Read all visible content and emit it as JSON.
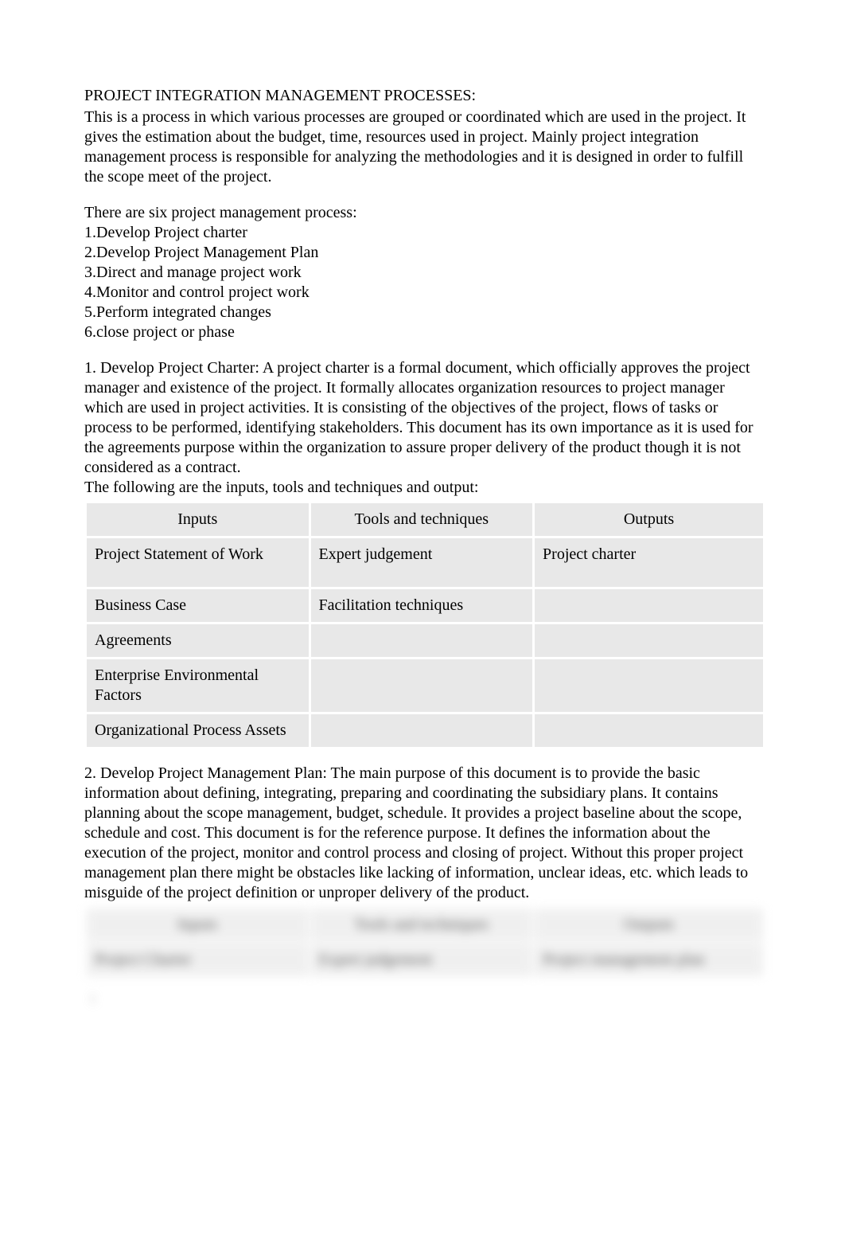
{
  "title": "PROJECT INTEGRATION MANAGEMENT PROCESSES:",
  "intro": "This is a process in which various processes are grouped or coordinated which are used in the project. It gives the estimation about the budget, time, resources used in project. Mainly project integration management process is responsible for analyzing the methodologies and it is designed in order to fulfill the scope meet of the project.",
  "list_intro": "There are six project management process:",
  "list": [
    "1.Develop Project charter",
    "2.Develop Project Management Plan",
    "3.Direct and manage project work",
    "4.Monitor and control project work",
    "5.Perform integrated changes",
    "6.close project or phase"
  ],
  "section1": {
    "text": "1. Develop Project Charter:     A project charter is a formal document, which officially approves the project manager and existence of the project. It formally allocates organization resources to project manager which are used in project activities. It is consisting of the objectives of the project, flows of tasks or process to be performed, identifying stakeholders. This document has its own importance as it is used for the agreements purpose within the organization to assure proper delivery of the product though it is not considered as a contract.",
    "table_lead": "The following are the inputs, tools and techniques and output:",
    "headers": [
      "Inputs",
      "Tools and techniques",
      "Outputs"
    ],
    "rows": [
      [
        "Project Statement of Work",
        "Expert judgement",
        "Project charter"
      ],
      [
        "Business Case",
        "Facilitation techniques",
        ""
      ],
      [
        "Agreements",
        "",
        ""
      ],
      [
        "Enterprise Environmental Factors",
        "",
        ""
      ],
      [
        "Organizational Process Assets",
        "",
        ""
      ]
    ]
  },
  "section2": {
    "text": "2. Develop Project Management Plan:     The main purpose of this document is to provide the basic information about defining, integrating, preparing and coordinating the subsidiary plans. It contains planning about the scope management, budget, schedule. It provides a project baseline about the scope, schedule and cost. This document is for the reference purpose. It defines the information about the execution of the project, monitor and control process and closing of project. Without this proper project management plan there might be obstacles like lacking of information, unclear ideas, etc. which leads to misguide of the project definition or unproper delivery of the product.",
    "headers": [
      "Inputs",
      "Tools and techniques",
      "Outputs"
    ],
    "rows": [
      [
        "Project Charter",
        "Expert judgement",
        "Project management plan"
      ]
    ]
  },
  "page_num": "1"
}
